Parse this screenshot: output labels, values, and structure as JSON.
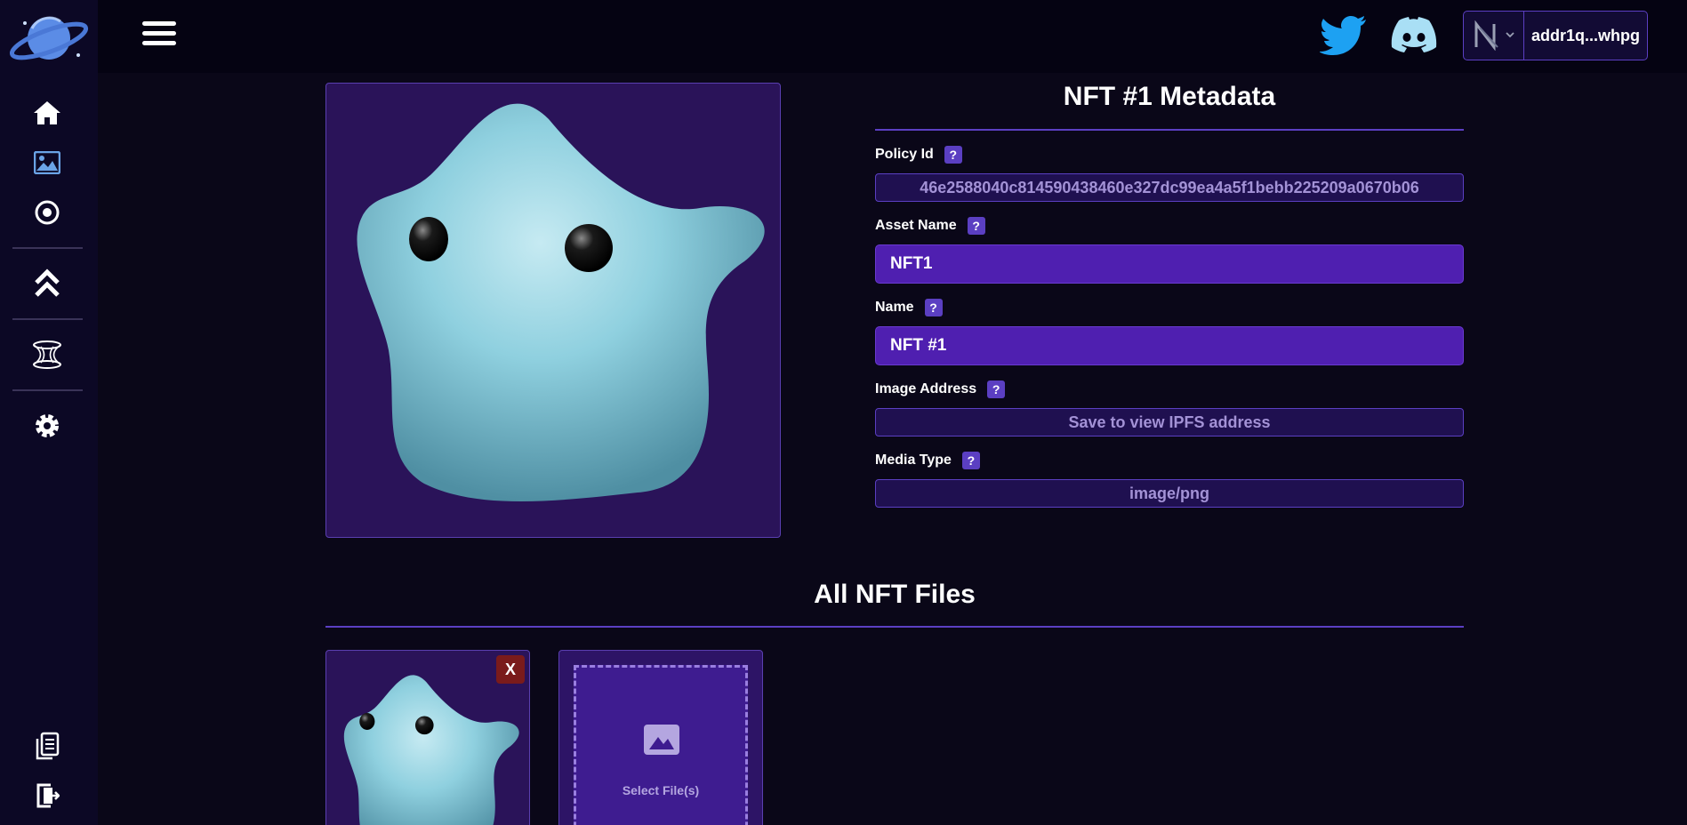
{
  "topbar": {
    "wallet_address": "addr1q...whpg"
  },
  "sidebar": {
    "icons": [
      "planet-logo-icon",
      "home-icon",
      "image-icon",
      "target-icon",
      "chevron-up-icon",
      "hourglass-icon",
      "gear-icon",
      "document-icon",
      "logout-icon"
    ]
  },
  "metadata": {
    "title": "NFT #1 Metadata",
    "help_glyph": "?",
    "policy_id": {
      "label": "Policy Id",
      "value": "46e2588040c814590438460e327dc99ea4a5f1bebb225209a0670b06"
    },
    "asset_name": {
      "label": "Asset Name",
      "value": "NFT1"
    },
    "name": {
      "label": "Name",
      "value": "NFT #1"
    },
    "image_address": {
      "label": "Image Address",
      "value": "Save to view IPFS address"
    },
    "media_type": {
      "label": "Media Type",
      "value": "image/png"
    }
  },
  "files": {
    "title": "All NFT Files",
    "remove_label": "X",
    "select_label": "Select File(s)"
  },
  "colors": {
    "background": "#0a0718",
    "sidebar": "#0c0825",
    "accent": "#5b3fc2",
    "input_fill": "#4f1fb0",
    "twitter": "#1da1f2",
    "discord": "#a9dff5",
    "remove": "#7a1b1b"
  }
}
